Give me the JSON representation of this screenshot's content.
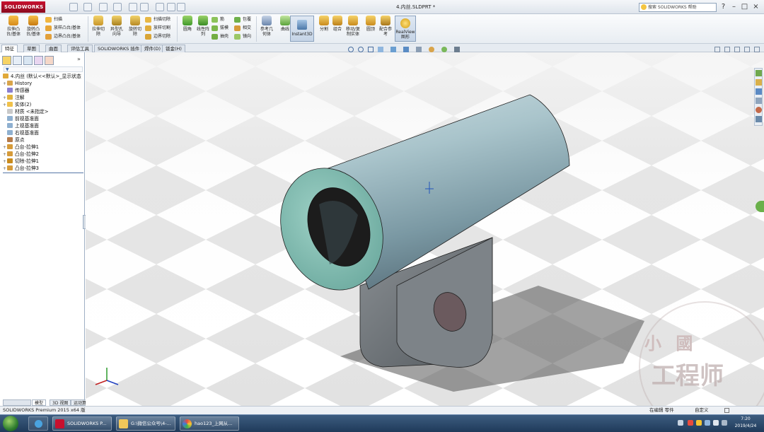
{
  "app": {
    "logo_text": "SOLIDWORKS",
    "document_title": "4.内丝.SLDPRT *",
    "help_search_placeholder": "搜索 SOLIDWORKS 帮助"
  },
  "ribbon": {
    "extrude_boss": "拉伸凸\n台/基体",
    "revolve_boss": "旋转凸\n台/基体",
    "sweep": "扫描",
    "loft": "放样凸台/基体",
    "boundary_boss": "边界凸台/基体",
    "extrude_cut": "拉伸切\n除",
    "hole_wizard": "异型孔\n向导",
    "revolve_cut": "旋转切\n除",
    "sweep_cut": "扫描切除",
    "loft_cut": "放样切割",
    "boundary_cut": "边界切除",
    "fillet": "圆角",
    "linear_pattern": "线性阵\n列",
    "rib": "筋",
    "draft": "拔模",
    "shell": "抽壳",
    "wrap": "包覆",
    "intersect": "相交",
    "mirror": "镜向",
    "ref_geometry": "参考几\n何体",
    "curves": "曲线",
    "instant3d": "Instant3D",
    "split": "分割",
    "combine": "组合",
    "move_copy": "移动/复\n制实体",
    "dome": "圆顶",
    "ref_ref": "配合参\n考",
    "realview": "RealView\n图形"
  },
  "command_tabs": [
    "特征",
    "草图",
    "曲面",
    "评估工具",
    "SOLIDWORKS 插件",
    "焊件(D)",
    "钣金(H)"
  ],
  "feature_tree": {
    "root": "4.内丝 (默认<<默认>_显示状态",
    "items": [
      {
        "label": "History",
        "expand": "+"
      },
      {
        "label": "传感器",
        "expand": ""
      },
      {
        "label": "注解",
        "expand": "+"
      },
      {
        "label": "实体(2)",
        "expand": "+"
      },
      {
        "label": "材质 <未指定>",
        "expand": ""
      },
      {
        "label": "前视基准面",
        "expand": ""
      },
      {
        "label": "上视基准面",
        "expand": ""
      },
      {
        "label": "右视基准面",
        "expand": ""
      },
      {
        "label": "原点",
        "expand": ""
      },
      {
        "label": "凸台-拉伸1",
        "expand": "+"
      },
      {
        "label": "凸台-拉伸2",
        "expand": "+"
      },
      {
        "label": "切除-拉伸1",
        "expand": "+"
      },
      {
        "label": "凸台-拉伸3",
        "expand": "+"
      }
    ],
    "panel_collapse": "»"
  },
  "bottom_tabs": [
    "模型",
    "3D 视图",
    "运动算例 1"
  ],
  "status": {
    "left": "SOLIDWORKS Premium 2015 x64 版",
    "editing": "在编辑 零件",
    "units": "自定义"
  },
  "taskbar": {
    "items": [
      "SOLIDWORKS P...",
      "G:\\微信公众号\\4-...",
      "hao123_上网从..."
    ],
    "time": "7:20",
    "date": "2019/4/24"
  },
  "watermark": {
    "top": "小 國",
    "bottom": "工程师"
  },
  "colors": {
    "logo_red": "#c8102e",
    "part_body": "#8fb0b8",
    "part_face": "#7bb3aa",
    "hole": "#6b5a5e"
  }
}
